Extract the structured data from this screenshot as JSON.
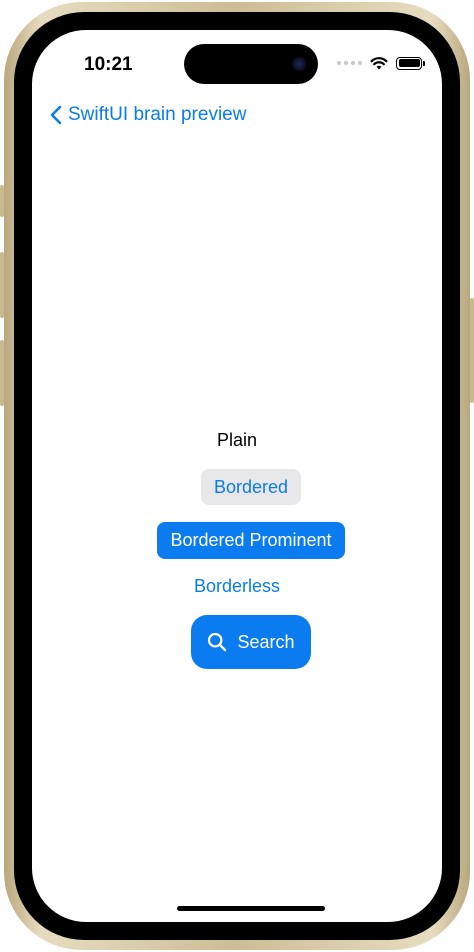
{
  "status_bar": {
    "time": "10:21",
    "icons": [
      "cellular-dots-icon",
      "wifi-icon",
      "battery-icon"
    ]
  },
  "nav": {
    "back_label": "SwiftUI brain preview",
    "back_icon": "chevron-left-icon"
  },
  "buttons": {
    "plain": "Plain",
    "bordered": "Bordered",
    "bordered_prominent": "Bordered Prominent",
    "borderless": "Borderless",
    "search": "Search",
    "search_icon": "magnifying-glass-icon"
  },
  "colors": {
    "accent": "#0a7cf0",
    "bordered_bg": "#e8e8ea",
    "frame_gold": "#cdbd95"
  }
}
